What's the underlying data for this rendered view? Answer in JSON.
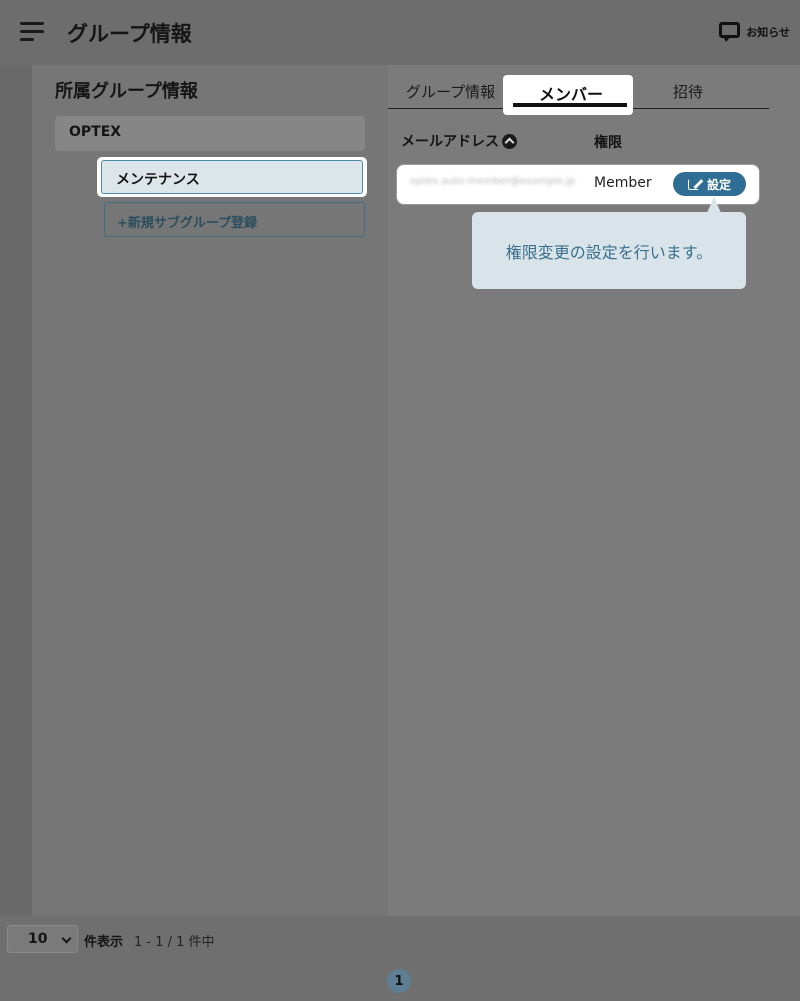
{
  "header": {
    "title": "グループ情報",
    "notice_label": "お知らせ"
  },
  "left": {
    "section_title": "所属グループ情報",
    "parent_group": "OPTEX",
    "subgroup": "メンテナンス",
    "add_subgroup_label": "+新規サブグループ登録"
  },
  "tabs": {
    "info": "グループ情報",
    "member": "メンバー",
    "invite": "招待"
  },
  "members": {
    "col_email": "メールアドレス",
    "col_role": "権限",
    "rows": [
      {
        "email": "optex.auto-member@example.jp",
        "role": "Member",
        "action": "設定"
      }
    ]
  },
  "tooltip": {
    "text": "権限変更の設定を行います。"
  },
  "footer": {
    "page_size": "10",
    "page_size_label": "件表示",
    "range_text": "1 - 1 / 1 件中",
    "current_page": "1"
  },
  "colors": {
    "accent": "#2f6d94",
    "tooltip_bg": "#d8e4ea",
    "tooltip_text": "#3b6f8c",
    "overlay": "#777777"
  },
  "icons": {
    "menu": "hamburger-menu-icon",
    "notice": "chat-bubble-icon",
    "sort": "chevron-up-circle-icon",
    "edit": "edit-icon",
    "select": "chevron-down-icon"
  }
}
